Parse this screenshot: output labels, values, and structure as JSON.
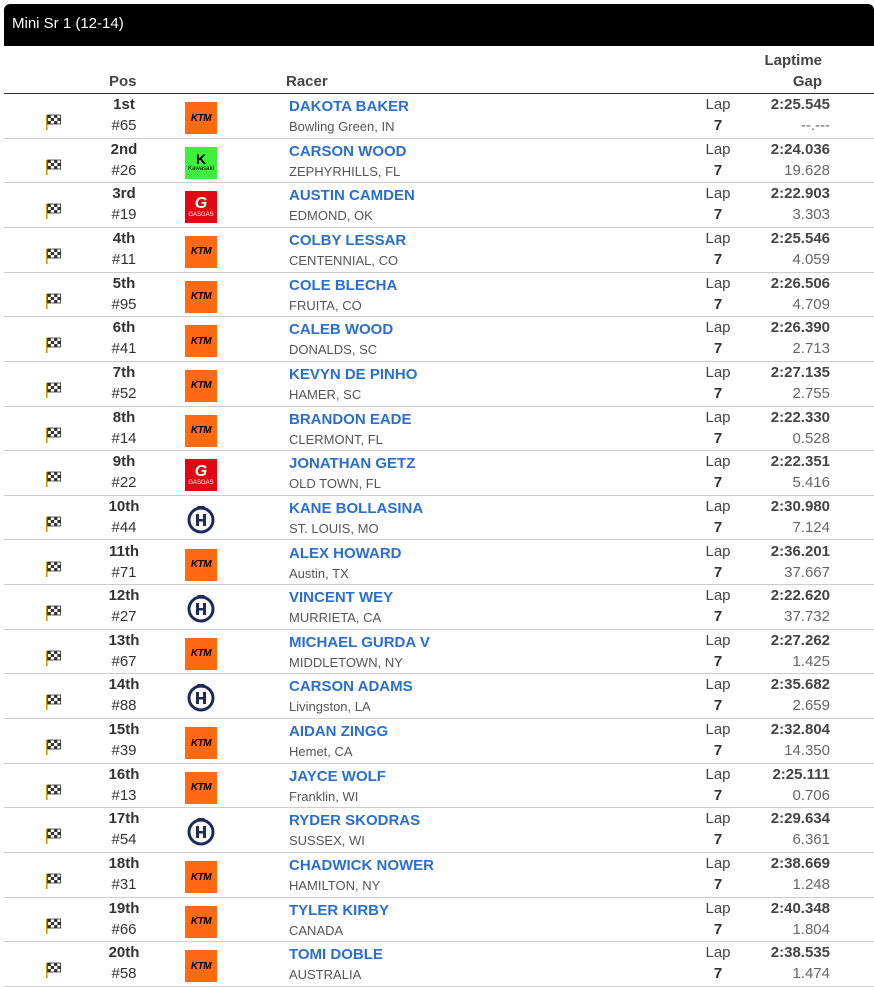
{
  "title": "Mini Sr 1 (12-14)",
  "headers": {
    "pos": "Pos",
    "racer": "Racer",
    "laptime": "Laptime",
    "gap": "Gap"
  },
  "lap_label": "Lap",
  "colors": {
    "link": "#2a6fce",
    "ktm": "#ff6a13",
    "kawasaki": "#3cf03c",
    "gasgas": "#e30613",
    "husqvarna": "#1d2a5a"
  },
  "rows": [
    {
      "pos": "1st",
      "num": "#65",
      "brand": "ktm",
      "name": "DAKOTA BAKER",
      "loc": "Bowling Green, IN",
      "lap": "7",
      "time": "2:25.545",
      "gap": "--.---"
    },
    {
      "pos": "2nd",
      "num": "#26",
      "brand": "kawasaki",
      "name": "CARSON WOOD",
      "loc": "ZEPHYRHILLS, FL",
      "lap": "7",
      "time": "2:24.036",
      "gap": "19.628"
    },
    {
      "pos": "3rd",
      "num": "#19",
      "brand": "gasgas",
      "name": "AUSTIN CAMDEN",
      "loc": "EDMOND, OK",
      "lap": "7",
      "time": "2:22.903",
      "gap": "3.303"
    },
    {
      "pos": "4th",
      "num": "#11",
      "brand": "ktm",
      "name": "COLBY LESSAR",
      "loc": "CENTENNIAL, CO",
      "lap": "7",
      "time": "2:25.546",
      "gap": "4.059"
    },
    {
      "pos": "5th",
      "num": "#95",
      "brand": "ktm",
      "name": "COLE BLECHA",
      "loc": "FRUITA, CO",
      "lap": "7",
      "time": "2:26.506",
      "gap": "4.709"
    },
    {
      "pos": "6th",
      "num": "#41",
      "brand": "ktm",
      "name": "CALEB WOOD",
      "loc": "DONALDS, SC",
      "lap": "7",
      "time": "2:26.390",
      "gap": "2.713"
    },
    {
      "pos": "7th",
      "num": "#52",
      "brand": "ktm",
      "name": "KEVYN DE PINHO",
      "loc": "HAMER, SC",
      "lap": "7",
      "time": "2:27.135",
      "gap": "2.755"
    },
    {
      "pos": "8th",
      "num": "#14",
      "brand": "ktm",
      "name": "BRANDON EADE",
      "loc": "CLERMONT, FL",
      "lap": "7",
      "time": "2:22.330",
      "gap": "0.528"
    },
    {
      "pos": "9th",
      "num": "#22",
      "brand": "gasgas",
      "name": "JONATHAN GETZ",
      "loc": "OLD TOWN, FL",
      "lap": "7",
      "time": "2:22.351",
      "gap": "5.416"
    },
    {
      "pos": "10th",
      "num": "#44",
      "brand": "husqvarna",
      "name": "KANE BOLLASINA",
      "loc": "ST. LOUIS, MO",
      "lap": "7",
      "time": "2:30.980",
      "gap": "7.124"
    },
    {
      "pos": "11th",
      "num": "#71",
      "brand": "ktm",
      "name": "ALEX HOWARD",
      "loc": "Austin, TX",
      "lap": "7",
      "time": "2:36.201",
      "gap": "37.667"
    },
    {
      "pos": "12th",
      "num": "#27",
      "brand": "husqvarna",
      "name": "VINCENT WEY",
      "loc": "MURRIETA, CA",
      "lap": "7",
      "time": "2:22.620",
      "gap": "37.732"
    },
    {
      "pos": "13th",
      "num": "#67",
      "brand": "ktm",
      "name": "MICHAEL GURDA V",
      "loc": "MIDDLETOWN, NY",
      "lap": "7",
      "time": "2:27.262",
      "gap": "1.425"
    },
    {
      "pos": "14th",
      "num": "#88",
      "brand": "husqvarna",
      "name": "CARSON ADAMS",
      "loc": "Livingston, LA",
      "lap": "7",
      "time": "2:35.682",
      "gap": "2.659"
    },
    {
      "pos": "15th",
      "num": "#39",
      "brand": "ktm",
      "name": "AIDAN ZINGG",
      "loc": "Hemet, CA",
      "lap": "7",
      "time": "2:32.804",
      "gap": "14.350"
    },
    {
      "pos": "16th",
      "num": "#13",
      "brand": "ktm",
      "name": "JAYCE WOLF",
      "loc": "Franklin, WI",
      "lap": "7",
      "time": "2:25.111",
      "gap": "0.706"
    },
    {
      "pos": "17th",
      "num": "#54",
      "brand": "husqvarna",
      "name": "RYDER SKODRAS",
      "loc": "SUSSEX, WI",
      "lap": "7",
      "time": "2:29.634",
      "gap": "6.361"
    },
    {
      "pos": "18th",
      "num": "#31",
      "brand": "ktm",
      "name": "CHADWICK NOWER",
      "loc": "HAMILTON, NY",
      "lap": "7",
      "time": "2:38.669",
      "gap": "1.248"
    },
    {
      "pos": "19th",
      "num": "#66",
      "brand": "ktm",
      "name": "TYLER KIRBY",
      "loc": "CANADA",
      "lap": "7",
      "time": "2:40.348",
      "gap": "1.804"
    },
    {
      "pos": "20th",
      "num": "#58",
      "brand": "ktm",
      "name": "TOMI DOBLE",
      "loc": "AUSTRALIA",
      "lap": "7",
      "time": "2:38.535",
      "gap": "1.474"
    }
  ]
}
